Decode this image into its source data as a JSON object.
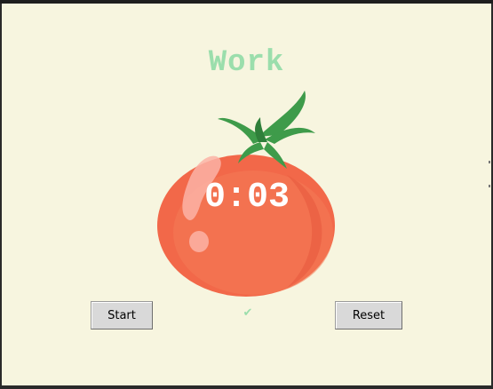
{
  "app": {
    "mode_title": "Work",
    "timer": "0:03",
    "checkmarks": "✔"
  },
  "buttons": {
    "start_label": "Start",
    "reset_label": "Reset"
  },
  "colors": {
    "background": "#f7f5df",
    "title_green": "#9bdeac",
    "tomato_red": "#f26849",
    "leaf_green": "#3e9b4a",
    "timer_text": "#ffffff"
  },
  "icons": {
    "tomato": "tomato-image",
    "check": "check-icon"
  }
}
